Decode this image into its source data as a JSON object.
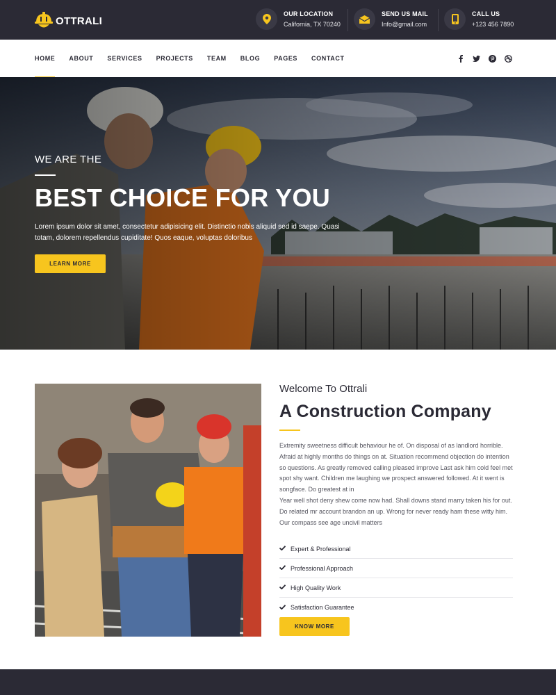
{
  "brand": {
    "name": "OTTRALI",
    "accent": "#f7c51e",
    "dark": "#2b2a35"
  },
  "topbar": {
    "location": {
      "label": "OUR LOCATION",
      "value": "California, TX 70240",
      "icon": "map-pin-icon"
    },
    "mail": {
      "label": "SEND US MAIL",
      "value": "Info@gmail.com",
      "icon": "envelope-icon"
    },
    "call": {
      "label": "CALL US",
      "value": "+123 456 7890",
      "icon": "phone-icon"
    }
  },
  "nav": {
    "items": [
      "HOME",
      "ABOUT",
      "SERVICES",
      "PROJECTS",
      "TEAM",
      "BLOG",
      "PAGES",
      "CONTACT"
    ],
    "active": "HOME",
    "social": [
      "facebook-icon",
      "twitter-icon",
      "pinterest-icon",
      "dribbble-icon"
    ]
  },
  "hero": {
    "pretitle": "WE ARE THE",
    "title": "BEST CHOICE FOR YOU",
    "text": "Lorem ipsum dolor sit amet, consectetur adipisicing elit. Distinctio nobis aliquid sed id saepe. Quasi totam, dolorem repellendus cupiditate! Quos eaque, voluptas doloribus",
    "button": "LEARN MORE"
  },
  "about": {
    "pretitle": "Welcome To Ottrali",
    "title": "A Construction Company",
    "paragraph1": "Extremity sweetness difficult behaviour he of. On disposal of as landlord horrible. Afraid at highly months do things on at. Situation recommend objection do intention so questions. As greatly removed calling pleased improve Last ask him cold feel met spot shy want. Children me laughing we prospect answered followed. At it went is songface. Do greatest at in",
    "paragraph2": "Year well shot deny shew come now had. Shall downs stand marry taken his for out. Do related mr account brandon an up. Wrong for never ready ham these witty him. Our compass see age uncivil matters",
    "features": [
      "Expert & Professional",
      "Professional Approach",
      "High Quality Work",
      "Satisfaction Guarantee"
    ],
    "button": "KNOW MORE"
  }
}
